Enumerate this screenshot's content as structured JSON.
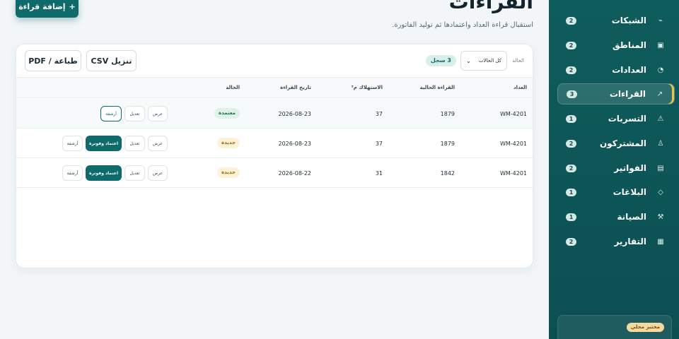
{
  "sidebar": {
    "top_fragment": "",
    "items": [
      {
        "label": "الشبكات",
        "badge": "2",
        "icon": "⌁"
      },
      {
        "label": "المناطق",
        "badge": "2",
        "icon": "▣"
      },
      {
        "label": "العدادات",
        "badge": "2",
        "icon": "◔"
      },
      {
        "label": "القراءات",
        "badge": "3",
        "icon": "↗"
      },
      {
        "label": "التسربات",
        "badge": "1",
        "icon": "⚠"
      },
      {
        "label": "المشتركون",
        "badge": "2",
        "icon": "♙"
      },
      {
        "label": "الفواتير",
        "badge": "2",
        "icon": "▤"
      },
      {
        "label": "البلاغات",
        "badge": "1",
        "icon": "◇"
      },
      {
        "label": "الصيانة",
        "badge": "1",
        "icon": "⚒"
      },
      {
        "label": "التقارير",
        "badge": "2",
        "icon": "▦"
      }
    ],
    "footer": {
      "lab_badge": "مختبر محلي"
    }
  },
  "header": {
    "title": "القراءات",
    "subtitle": "استقبال قراءة العداد واعتمادها ثم توليد الفاتورة.",
    "add_button": "إضافة قراءة",
    "add_icon": "+"
  },
  "toolbar": {
    "print_label": "طباعة / PDF",
    "csv_label": "تنزيل CSV",
    "filter_label": "الحالة",
    "status_selected": "كل الحالات",
    "count_badge": "3 سجل"
  },
  "table": {
    "headers": {
      "meter": "العداد",
      "current": "القراءة الحالية",
      "consumption": "الاستهلاك م³",
      "date": "تاريخ القراءة",
      "status": "الحالة"
    },
    "rows": [
      {
        "meter": "WM-4201",
        "current": "1879",
        "consumption": "37",
        "date": "2026-08-23",
        "status": "معتمدة",
        "status_type": "approved",
        "actions": {
          "view": "عرض",
          "edit": "تعديل",
          "archive": "أرشفة"
        }
      },
      {
        "meter": "WM-4201",
        "current": "1879",
        "consumption": "37",
        "date": "2026-08-23",
        "status": "جديدة",
        "status_type": "new",
        "actions": {
          "view": "عرض",
          "edit": "تعديل",
          "approve": "اعتماد وفوترة",
          "archive": "أرشفة"
        }
      },
      {
        "meter": "WM-4201",
        "current": "1842",
        "consumption": "31",
        "date": "2026-08-22",
        "status": "جديدة",
        "status_type": "new",
        "actions": {
          "view": "عرض",
          "edit": "تعديل",
          "approve": "اعتماد وفوترة",
          "archive": "أرشفة"
        }
      }
    ]
  },
  "colors": {
    "sidebar": "#0f5c5c",
    "accent": "#0f6b6b",
    "approved": "#167152",
    "new": "#a66a07",
    "active_indicator": "#f0c04a"
  }
}
